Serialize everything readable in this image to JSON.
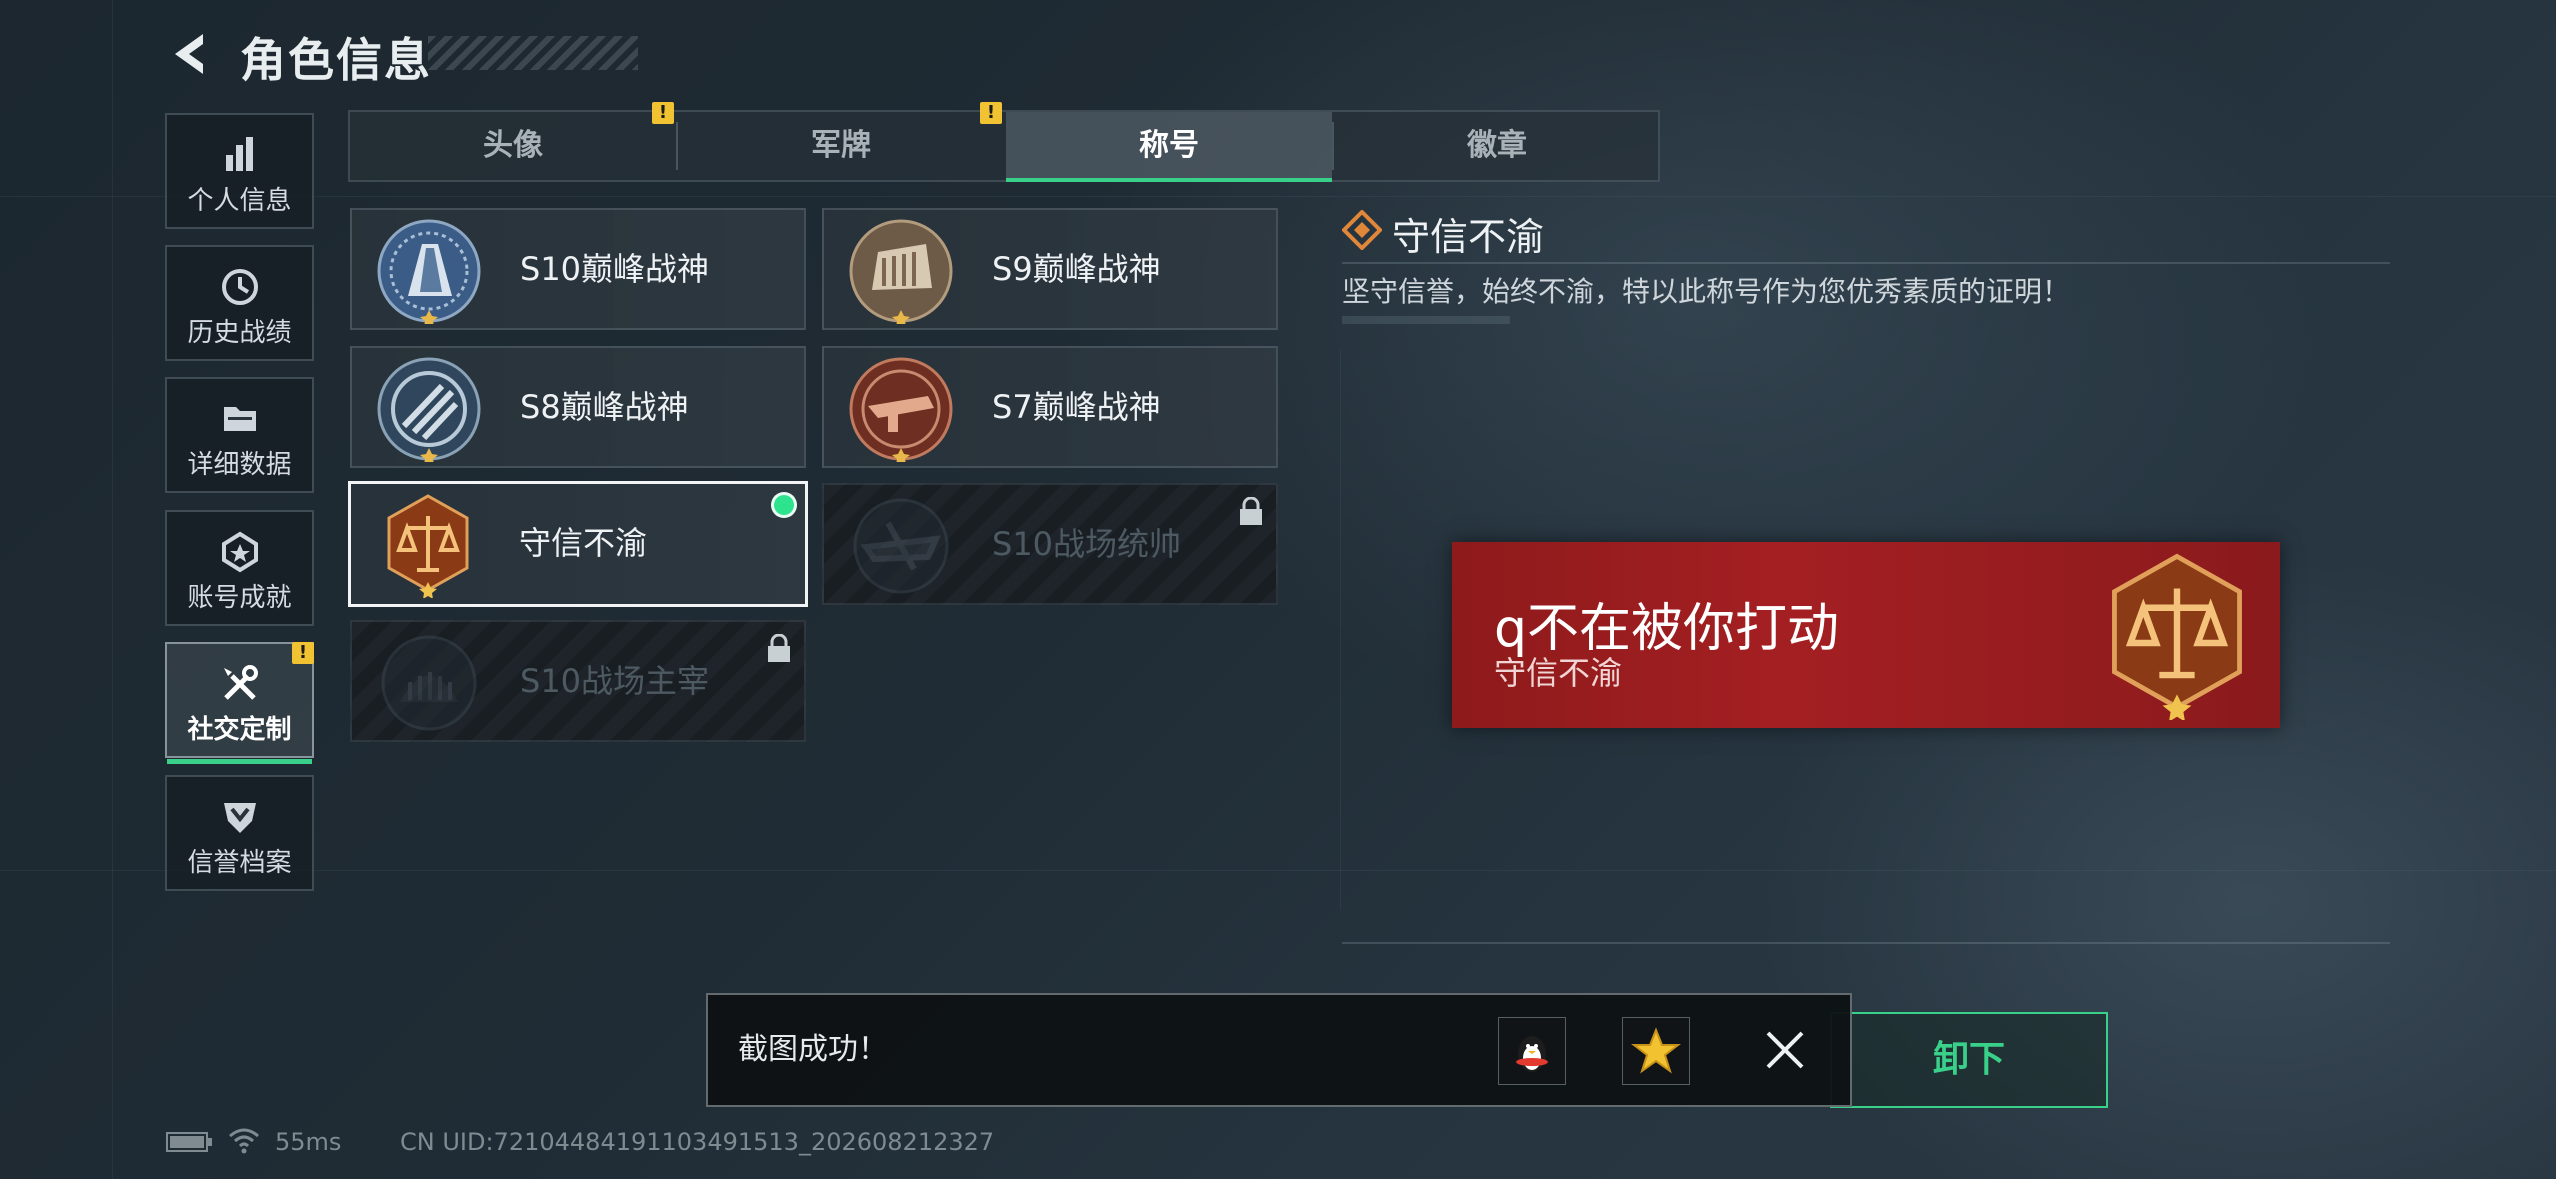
{
  "header": {
    "title": "角色信息"
  },
  "nav": [
    {
      "label": "个人信息",
      "icon": "bar-chart-icon"
    },
    {
      "label": "历史战绩",
      "icon": "clock-icon"
    },
    {
      "label": "详细数据",
      "icon": "folder-icon"
    },
    {
      "label": "账号成就",
      "icon": "medal-icon"
    },
    {
      "label": "社交定制",
      "icon": "tools-icon",
      "active": true,
      "alert": true
    },
    {
      "label": "信誉档案",
      "icon": "shield-icon"
    }
  ],
  "tabs": [
    {
      "label": "头像",
      "alert": true
    },
    {
      "label": "军牌",
      "alert": true
    },
    {
      "label": "称号",
      "active": true
    },
    {
      "label": "徽章"
    }
  ],
  "titles": [
    {
      "name": "S10巅峰战神",
      "locked": false
    },
    {
      "name": "S9巅峰战神",
      "locked": false
    },
    {
      "name": "S8巅峰战神",
      "locked": false
    },
    {
      "name": "S7巅峰战神",
      "locked": false
    },
    {
      "name": "守信不渝",
      "locked": false,
      "selected": true
    },
    {
      "name": "S10战场统帅",
      "locked": true
    },
    {
      "name": "S10战场主宰",
      "locked": true
    }
  ],
  "detail": {
    "name": "守信不渝",
    "description": "坚守信誉，始终不渝，特以此称号作为您优秀素质的证明！",
    "banner_player": "q不在被你打动",
    "banner_title": "守信不渝",
    "action_label": "卸下"
  },
  "toast": {
    "message": "截图成功！"
  },
  "status": {
    "latency": "55ms",
    "uid": "CN UID:7210448419110349​1513_202608212327"
  },
  "colors": {
    "accent": "#39d08a",
    "banner": "#a41f22",
    "warning": "#f1c232"
  }
}
